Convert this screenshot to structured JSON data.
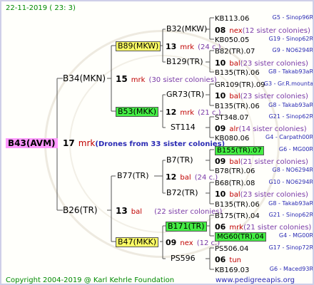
{
  "header": {
    "date": "22-11-2019 ( 23: 3)"
  },
  "footer": {
    "copyright": "Copyright 2004-2019 @ Karl Kehrle Foundation",
    "site": "www.pedigreeapis.org"
  },
  "root": {
    "name": "B43(AVM)",
    "count": "17",
    "unit": "mrk",
    "colonies": "(Drones from 33 sister colonies)"
  },
  "gen1": [
    {
      "name": "B34(MKN)",
      "count": "15",
      "unit": "mrk",
      "colonies": "(30 sister colonies)"
    },
    {
      "name": "B26(TR)",
      "count": "13",
      "unit": "bal",
      "colonies": "(22 sister colonies)"
    }
  ],
  "gen2": [
    {
      "name": "B89(MKW)",
      "count": "13",
      "unit": "mrk",
      "colonies": "(24 c.)"
    },
    {
      "name": "B53(MKK)",
      "count": "12",
      "unit": "mrk",
      "colonies": "(21 c.)"
    },
    {
      "name": "B77(TR)",
      "count": "12",
      "unit": "bal",
      "colonies": "(24 c.)"
    },
    {
      "name": "B47(MKK)",
      "count": "09",
      "unit": "nex",
      "colonies": "(12 c.)"
    }
  ],
  "gen3": [
    {
      "name": "B32(MKW)",
      "count": "08",
      "unit": "nex",
      "colonies": "(12 sister colonies)"
    },
    {
      "name": "B129(TR)",
      "count": "10",
      "unit": "bal",
      "colonies": "(23 sister colonies)"
    },
    {
      "name": "GR73(TR)",
      "count": "10",
      "unit": "bal",
      "colonies": "(23 sister colonies)"
    },
    {
      "name": "ST114",
      "count": "09",
      "unit": "alr",
      "colonies": "(14 sister colonies)"
    },
    {
      "name": "B7(TR)",
      "count": "09",
      "unit": "bal",
      "colonies": "(21 sister colonies)"
    },
    {
      "name": "B72(TR)",
      "count": "10",
      "unit": "bal",
      "colonies": "(23 sister colonies)"
    },
    {
      "name": "B171(TR)",
      "count": "06",
      "unit": "mrk",
      "colonies": "(21 sister colonies)"
    },
    {
      "name": "PS596",
      "count": "06",
      "unit": "tun",
      "colonies": ""
    }
  ],
  "gen4": [
    {
      "name": "KB113.06",
      "origin": "G5 - Sinop96R",
      "hl": ""
    },
    {
      "name": "KB050.05",
      "origin": "G19 - Sinop62R",
      "hl": ""
    },
    {
      "name": "B82(TR).07",
      "origin": "G9 - NO6294R",
      "hl": ""
    },
    {
      "name": "B135(TR).06",
      "origin": "G8 - Takab93aR",
      "hl": ""
    },
    {
      "name": "GR109(TR).09",
      "origin": "G3 - Gr.R.mounta",
      "hl": ""
    },
    {
      "name": "B135(TR).06",
      "origin": "G8 - Takab93aR",
      "hl": ""
    },
    {
      "name": "ST348.07",
      "origin": "G21 - Sinop62R",
      "hl": ""
    },
    {
      "name": "KB080.06",
      "origin": "G4 - Carpath00R",
      "hl": ""
    },
    {
      "name": "B155(TR).07",
      "origin": "G6 - MG00R",
      "hl": "lime"
    },
    {
      "name": "B78(TR).06",
      "origin": "G8 - NO6294R",
      "hl": ""
    },
    {
      "name": "B68(TR).08",
      "origin": "G10 - NO6294R",
      "hl": ""
    },
    {
      "name": "B135(TR).06",
      "origin": "G8 - Takab93aR",
      "hl": ""
    },
    {
      "name": "B175(TR).04",
      "origin": "G21 - Sinop62R",
      "hl": ""
    },
    {
      "name": "MG60(TR).04",
      "origin": "G4 - MG00R",
      "hl": "lime"
    },
    {
      "name": "PS506.04",
      "origin": "G17 - Sinop72R",
      "hl": ""
    },
    {
      "name": "KB169.03",
      "origin": "G6 - Maced93R",
      "hl": ""
    }
  ]
}
